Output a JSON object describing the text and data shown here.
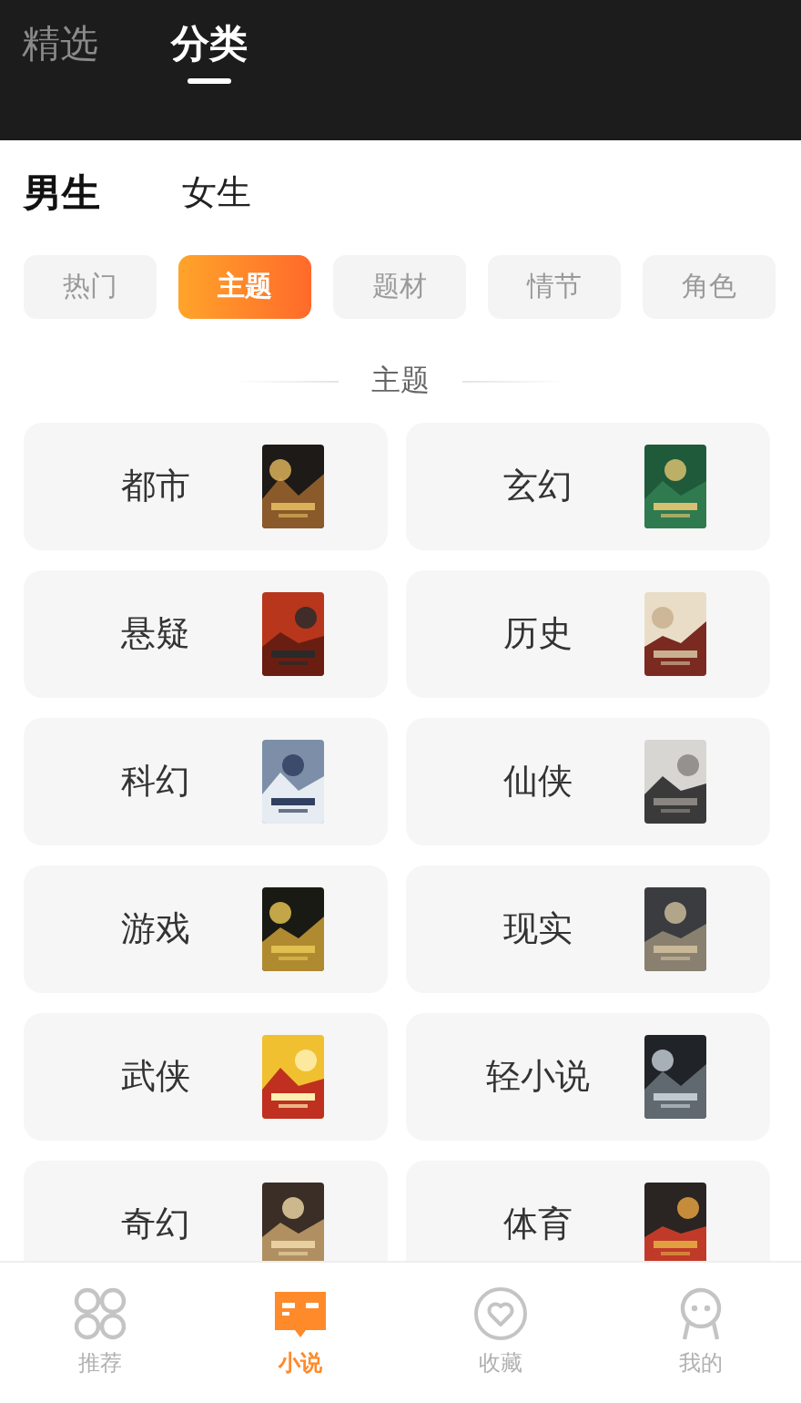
{
  "top_tabs": [
    {
      "label": "精选",
      "selected": false
    },
    {
      "label": "分类",
      "selected": true
    }
  ],
  "gender_tabs": [
    {
      "label": "男生",
      "selected": true
    },
    {
      "label": "女生",
      "selected": false
    }
  ],
  "filter_chips": [
    {
      "label": "热门",
      "selected": false
    },
    {
      "label": "主题",
      "selected": true
    },
    {
      "label": "题材",
      "selected": false
    },
    {
      "label": "情节",
      "selected": false
    },
    {
      "label": "角色",
      "selected": false
    }
  ],
  "section_title": "主题",
  "categories": [
    {
      "label": "都市"
    },
    {
      "label": "玄幻"
    },
    {
      "label": "悬疑"
    },
    {
      "label": "历史"
    },
    {
      "label": "科幻"
    },
    {
      "label": "仙侠"
    },
    {
      "label": "游戏"
    },
    {
      "label": "现实"
    },
    {
      "label": "武侠"
    },
    {
      "label": "轻小说"
    },
    {
      "label": "奇幻"
    },
    {
      "label": "体育"
    }
  ],
  "bottom_nav": [
    {
      "label": "推荐",
      "kind": "grid",
      "selected": false
    },
    {
      "label": "小说",
      "kind": "book",
      "selected": true
    },
    {
      "label": "收藏",
      "kind": "heart",
      "selected": false
    },
    {
      "label": "我的",
      "kind": "person",
      "selected": false
    }
  ]
}
